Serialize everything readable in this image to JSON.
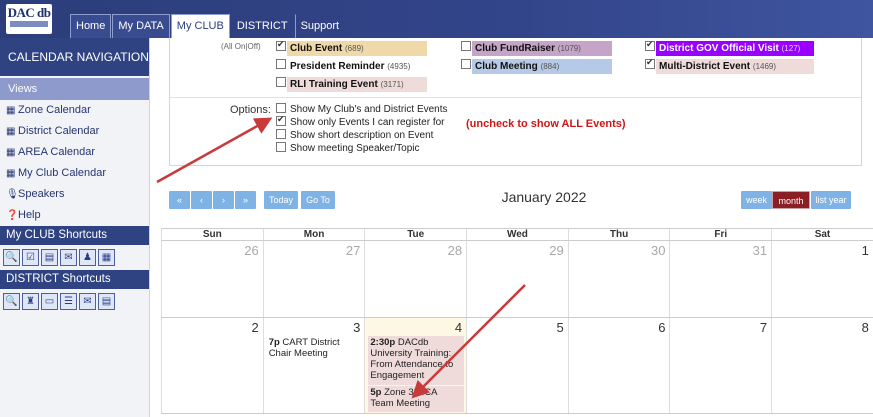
{
  "logo": {
    "text": "DAC db"
  },
  "nav": {
    "tabs": [
      {
        "label": "Home"
      },
      {
        "label": "My DATA"
      },
      {
        "label": "My CLUB"
      },
      {
        "label": "DISTRICT"
      },
      {
        "label": "Support"
      }
    ],
    "active": "My CLUB"
  },
  "sidebar": {
    "title": "CALENDAR NAVIGATION",
    "views_header": "Views",
    "items": [
      {
        "label": "Zone Calendar",
        "icon": "calendar-icon"
      },
      {
        "label": "District Calendar",
        "icon": "calendar-icon"
      },
      {
        "label": "AREA Calendar",
        "icon": "calendar-icon"
      },
      {
        "label": "My Club Calendar",
        "icon": "calendar-icon"
      },
      {
        "label": "Speakers",
        "icon": "microphone-icon"
      },
      {
        "label": "Help",
        "icon": "question-circle-icon"
      }
    ],
    "club_shortcuts": {
      "title": "My CLUB Shortcuts"
    },
    "district_shortcuts": {
      "title": "DISTRICT Shortcuts"
    }
  },
  "filters": {
    "all_on_off": "(All On|Off)",
    "events": [
      {
        "label": "Club Event",
        "count": "(689)",
        "checked": true,
        "color": "#f0d9a8"
      },
      {
        "label": "President Reminder",
        "count": "(4935)",
        "checked": false,
        "color": "#ffffff"
      },
      {
        "label": "RLI Training Event",
        "count": "(3171)",
        "checked": false,
        "color": "#f0dbdb"
      },
      {
        "label": "Club FundRaiser",
        "count": "(1079)",
        "checked": false,
        "color": "#c4a4c7"
      },
      {
        "label": "Club Meeting",
        "count": "(884)",
        "checked": false,
        "color": "#b6c9e6"
      },
      {
        "label": "District GOV Official Visit",
        "count": "(127)",
        "checked": true,
        "color": "#9900ff"
      },
      {
        "label": "Multi-District Event",
        "count": "(1469)",
        "checked": true,
        "color": "#f0dbdb"
      }
    ],
    "options_label": "Options:",
    "options": [
      {
        "label": "Show My Club's and District Events",
        "checked": false
      },
      {
        "label": "Show only Events I can register for",
        "checked": true
      },
      {
        "label": "Show short description on Event",
        "checked": false
      },
      {
        "label": "Show meeting Speaker/Topic",
        "checked": false
      }
    ],
    "uncheck_note": "(uncheck to show ALL Events)"
  },
  "calendar": {
    "title": "January 2022",
    "buttons": {
      "prev_year": "«",
      "prev": "‹",
      "next": "›",
      "next_year": "»",
      "today": "Today",
      "goto": "Go To",
      "week": "week",
      "month": "month",
      "list_year": "list year"
    },
    "active_view": "month",
    "days_of_week": [
      "Sun",
      "Mon",
      "Tue",
      "Wed",
      "Thu",
      "Fri",
      "Sat"
    ],
    "weeks": [
      [
        "26",
        "27",
        "28",
        "29",
        "30",
        "31",
        "1"
      ],
      [
        "2",
        "3",
        "4",
        "5",
        "6",
        "7",
        "8"
      ]
    ],
    "events": [
      {
        "time": "7p",
        "title": "CART District Chair Meeting"
      },
      {
        "time": "2:30p",
        "title": "DACdb University Training: From Attendance to Engagement"
      },
      {
        "time": "5p",
        "title": "Zone 33 ICA Team Meeting"
      }
    ]
  }
}
